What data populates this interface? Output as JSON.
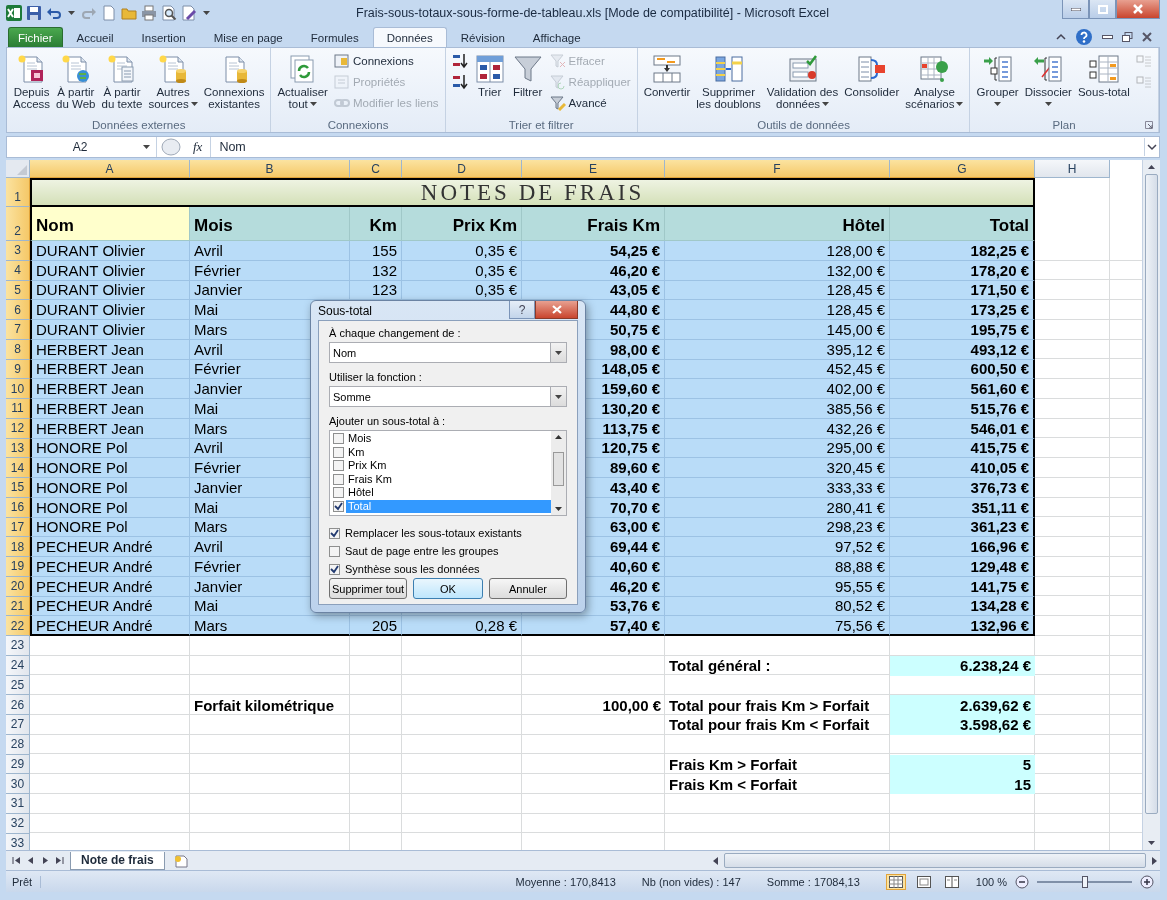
{
  "window": {
    "title": "Frais-sous-totaux-sous-forme-de-tableau.xls  [Mode de compatibilité]  -  Microsoft Excel"
  },
  "ribbon_tabs": [
    {
      "label": "Fichier",
      "kind": "file",
      "selected": false
    },
    {
      "label": "Accueil",
      "kind": "tab",
      "selected": false
    },
    {
      "label": "Insertion",
      "kind": "tab",
      "selected": false
    },
    {
      "label": "Mise en page",
      "kind": "tab",
      "selected": false
    },
    {
      "label": "Formules",
      "kind": "tab",
      "selected": false
    },
    {
      "label": "Données",
      "kind": "tab",
      "selected": true
    },
    {
      "label": "Révision",
      "kind": "tab",
      "selected": false
    },
    {
      "label": "Affichage",
      "kind": "tab",
      "selected": false
    }
  ],
  "ribbon_groups": [
    {
      "label": "Données externes",
      "launcher": false,
      "items": [
        {
          "kind": "large",
          "lines": [
            "Depuis",
            "Access"
          ],
          "menu": false
        },
        {
          "kind": "large",
          "lines": [
            "À partir",
            "du Web"
          ],
          "menu": false
        },
        {
          "kind": "large",
          "lines": [
            "À partir",
            "du texte"
          ],
          "menu": false
        },
        {
          "kind": "large",
          "lines": [
            "Autres",
            "sources"
          ],
          "menu": true
        },
        {
          "kind": "large",
          "lines": [
            "Connexions",
            "existantes"
          ],
          "menu": false
        }
      ]
    },
    {
      "label": "Connexions",
      "launcher": false,
      "items": [
        {
          "kind": "large",
          "lines": [
            "Actualiser",
            "tout"
          ],
          "menu": true
        },
        {
          "kind": "stack",
          "buttons": [
            {
              "label": "Connexions",
              "disabled": false
            },
            {
              "label": "Propriétés",
              "disabled": true
            },
            {
              "label": "Modifier les liens",
              "disabled": true
            }
          ]
        }
      ]
    },
    {
      "label": "Trier et filtrer",
      "launcher": false,
      "items": [
        {
          "kind": "stack",
          "buttons": [
            {
              "disabled": false
            },
            {
              "disabled": false
            }
          ]
        },
        {
          "kind": "large",
          "lines": [
            "Trier"
          ],
          "menu": false
        },
        {
          "kind": "large",
          "lines": [
            "Filtrer"
          ],
          "menu": false
        },
        {
          "kind": "stack",
          "buttons": [
            {
              "label": "Effacer",
              "disabled": true
            },
            {
              "label": "Réappliquer",
              "disabled": true
            },
            {
              "label": "Avancé",
              "disabled": false
            }
          ]
        }
      ]
    },
    {
      "label": "Outils de données",
      "launcher": false,
      "items": [
        {
          "kind": "large",
          "lines": [
            "Convertir"
          ],
          "menu": false
        },
        {
          "kind": "large",
          "lines": [
            "Supprimer",
            "les doublons"
          ],
          "menu": false
        },
        {
          "kind": "large",
          "lines": [
            "Validation des",
            "données"
          ],
          "menu": true
        },
        {
          "kind": "large",
          "lines": [
            "Consolider"
          ],
          "menu": false
        },
        {
          "kind": "large",
          "lines": [
            "Analyse",
            "scénarios"
          ],
          "menu": true
        }
      ]
    },
    {
      "label": "Plan",
      "launcher": true,
      "items": [
        {
          "kind": "large",
          "lines": [
            "Grouper"
          ],
          "menu": true
        },
        {
          "kind": "large",
          "lines": [
            "Dissocier"
          ],
          "menu": true
        },
        {
          "kind": "large",
          "lines": [
            "Sous-total"
          ],
          "menu": false
        },
        {
          "kind": "stack",
          "buttons": [
            {
              "disabled": true
            },
            {
              "disabled": true
            }
          ]
        }
      ]
    }
  ],
  "formula_bar": {
    "name_box": "A2",
    "fx": "fx",
    "content": "Nom"
  },
  "sheet": {
    "columns": [
      {
        "label": "A",
        "selected": true
      },
      {
        "label": "B",
        "selected": true
      },
      {
        "label": "C",
        "selected": true
      },
      {
        "label": "D",
        "selected": true
      },
      {
        "label": "E",
        "selected": true
      },
      {
        "label": "F",
        "selected": true
      },
      {
        "label": "G",
        "selected": true
      },
      {
        "label": "H",
        "selected": false
      }
    ],
    "rows": [
      {
        "number": "1",
        "selected": true,
        "kind": "title",
        "cells": [
          "NOTES DE FRAIS"
        ]
      },
      {
        "number": "2",
        "selected": true,
        "kind": "header",
        "cells": [
          "Nom",
          "Mois",
          "Km",
          "Prix Km",
          "Frais Km",
          "Hôtel",
          "Total"
        ]
      },
      {
        "number": "3",
        "selected": true,
        "kind": "data",
        "cells": [
          "DURANT Olivier",
          "Avril",
          "155",
          "0,35 €",
          "54,25 €",
          "128,00 €",
          "182,25 €"
        ]
      },
      {
        "number": "4",
        "selected": true,
        "kind": "data",
        "cells": [
          "DURANT Olivier",
          "Février",
          "132",
          "0,35 €",
          "46,20 €",
          "132,00 €",
          "178,20 €"
        ]
      },
      {
        "number": "5",
        "selected": true,
        "kind": "data",
        "cells": [
          "DURANT Olivier",
          "Janvier",
          "123",
          "0,35 €",
          "43,05 €",
          "128,45 €",
          "171,50 €"
        ]
      },
      {
        "number": "6",
        "selected": true,
        "kind": "data",
        "cells": [
          "DURANT Olivier",
          "Mai",
          null,
          null,
          "44,80 €",
          "128,45 €",
          "173,25 €"
        ]
      },
      {
        "number": "7",
        "selected": true,
        "kind": "data",
        "cells": [
          "DURANT Olivier",
          "Mars",
          null,
          null,
          "50,75 €",
          "145,00 €",
          "195,75 €"
        ]
      },
      {
        "number": "8",
        "selected": true,
        "kind": "data",
        "cells": [
          "HERBERT Jean",
          "Avril",
          null,
          null,
          "98,00 €",
          "395,12 €",
          "493,12 €"
        ]
      },
      {
        "number": "9",
        "selected": true,
        "kind": "data",
        "cells": [
          "HERBERT Jean",
          "Février",
          null,
          null,
          "148,05 €",
          "452,45 €",
          "600,50 €"
        ]
      },
      {
        "number": "10",
        "selected": true,
        "kind": "data",
        "cells": [
          "HERBERT Jean",
          "Janvier",
          null,
          null,
          "159,60 €",
          "402,00 €",
          "561,60 €"
        ]
      },
      {
        "number": "11",
        "selected": true,
        "kind": "data",
        "cells": [
          "HERBERT Jean",
          "Mai",
          null,
          null,
          "130,20 €",
          "385,56 €",
          "515,76 €"
        ]
      },
      {
        "number": "12",
        "selected": true,
        "kind": "data",
        "cells": [
          "HERBERT Jean",
          "Mars",
          null,
          null,
          "113,75 €",
          "432,26 €",
          "546,01 €"
        ]
      },
      {
        "number": "13",
        "selected": true,
        "kind": "data",
        "cells": [
          "HONORE Pol",
          "Avril",
          null,
          null,
          "120,75 €",
          "295,00 €",
          "415,75 €"
        ]
      },
      {
        "number": "14",
        "selected": true,
        "kind": "data",
        "cells": [
          "HONORE Pol",
          "Février",
          null,
          null,
          "89,60 €",
          "320,45 €",
          "410,05 €"
        ]
      },
      {
        "number": "15",
        "selected": true,
        "kind": "data",
        "cells": [
          "HONORE Pol",
          "Janvier",
          null,
          null,
          "43,40 €",
          "333,33 €",
          "376,73 €"
        ]
      },
      {
        "number": "16",
        "selected": true,
        "kind": "data",
        "cells": [
          "HONORE Pol",
          "Mai",
          null,
          null,
          "70,70 €",
          "280,41 €",
          "351,11 €"
        ]
      },
      {
        "number": "17",
        "selected": true,
        "kind": "data",
        "cells": [
          "HONORE Pol",
          "Mars",
          null,
          null,
          "63,00 €",
          "298,23 €",
          "361,23 €"
        ]
      },
      {
        "number": "18",
        "selected": true,
        "kind": "data",
        "cells": [
          "PECHEUR André",
          "Avril",
          null,
          null,
          "69,44 €",
          "97,52 €",
          "166,96 €"
        ]
      },
      {
        "number": "19",
        "selected": true,
        "kind": "data",
        "cells": [
          "PECHEUR André",
          "Février",
          null,
          null,
          "40,60 €",
          "88,88 €",
          "129,48 €"
        ]
      },
      {
        "number": "20",
        "selected": true,
        "kind": "data",
        "cells": [
          "PECHEUR André",
          "Janvier",
          null,
          null,
          "46,20 €",
          "95,55 €",
          "141,75 €"
        ]
      },
      {
        "number": "21",
        "selected": true,
        "kind": "data",
        "cells": [
          "PECHEUR André",
          "Mai",
          null,
          null,
          "53,76 €",
          "80,52 €",
          "134,28 €"
        ]
      },
      {
        "number": "22",
        "selected": true,
        "kind": "data",
        "cells": [
          "PECHEUR André",
          "Mars",
          "205",
          "0,28 €",
          "57,40 €",
          "75,56 €",
          "132,96 €"
        ]
      },
      {
        "number": "23",
        "selected": false,
        "kind": "empty"
      },
      {
        "number": "24",
        "selected": false,
        "kind": "summary",
        "cells": [
          null,
          null,
          null,
          null,
          null,
          "Total général :",
          "6.238,24 €"
        ]
      },
      {
        "number": "25",
        "selected": false,
        "kind": "empty"
      },
      {
        "number": "26",
        "selected": false,
        "kind": "summary",
        "cells": [
          null,
          "Forfait kilométrique",
          null,
          null,
          "100,00 €",
          "Total pour frais Km > Forfait",
          "2.639,62 €"
        ]
      },
      {
        "number": "27",
        "selected": false,
        "kind": "summary",
        "cells": [
          null,
          null,
          null,
          null,
          null,
          "Total pour frais Km < Forfait",
          "3.598,62 €"
        ]
      },
      {
        "number": "28",
        "selected": false,
        "kind": "empty"
      },
      {
        "number": "29",
        "selected": false,
        "kind": "summary",
        "cells": [
          null,
          null,
          null,
          null,
          null,
          "Frais Km > Forfait",
          "5"
        ]
      },
      {
        "number": "30",
        "selected": false,
        "kind": "summary",
        "cells": [
          null,
          null,
          null,
          null,
          null,
          "Frais Km < Forfait",
          "15"
        ]
      },
      {
        "number": "31",
        "selected": false,
        "kind": "empty"
      },
      {
        "number": "32",
        "selected": false,
        "kind": "empty"
      },
      {
        "number": "33",
        "selected": false,
        "kind": "empty"
      }
    ]
  },
  "dialog": {
    "title": "Sous-total",
    "help": "?",
    "group_by_label": "À chaque changement de :",
    "group_by": "Nom",
    "function_label": "Utiliser la fonction :",
    "function": "Somme",
    "add_label": "Ajouter un sous-total à :",
    "fields": [
      {
        "label": "Mois",
        "checked": false,
        "selected": false
      },
      {
        "label": "Km",
        "checked": false,
        "selected": false
      },
      {
        "label": "Prix Km",
        "checked": false,
        "selected": false
      },
      {
        "label": "Frais Km",
        "checked": false,
        "selected": false
      },
      {
        "label": "Hôtel",
        "checked": false,
        "selected": false
      },
      {
        "label": "Total",
        "checked": true,
        "selected": true
      }
    ],
    "options": [
      {
        "label": "Remplacer les sous-totaux existants",
        "checked": true
      },
      {
        "label": "Saut de page entre les groupes",
        "checked": false
      },
      {
        "label": "Synthèse sous les données",
        "checked": true
      }
    ],
    "buttons": [
      {
        "label": "Supprimer tout",
        "default": false
      },
      {
        "label": "OK",
        "default": true
      },
      {
        "label": "Annuler",
        "default": false
      }
    ]
  },
  "sheet_tabs": [
    {
      "label": "Note de frais",
      "selected": true
    }
  ],
  "status_bar": {
    "ready": "Prêt",
    "stats": [
      "Moyenne : 170,8413",
      "Nb (non vides) : 147",
      "Somme : 17084,13"
    ],
    "views": [
      {
        "kind": "normal",
        "selected": true
      },
      {
        "kind": "layout",
        "selected": false
      },
      {
        "kind": "preview",
        "selected": false
      }
    ],
    "zoom": "100 %",
    "zoom_slider": {
      "level": 0.5
    }
  }
}
